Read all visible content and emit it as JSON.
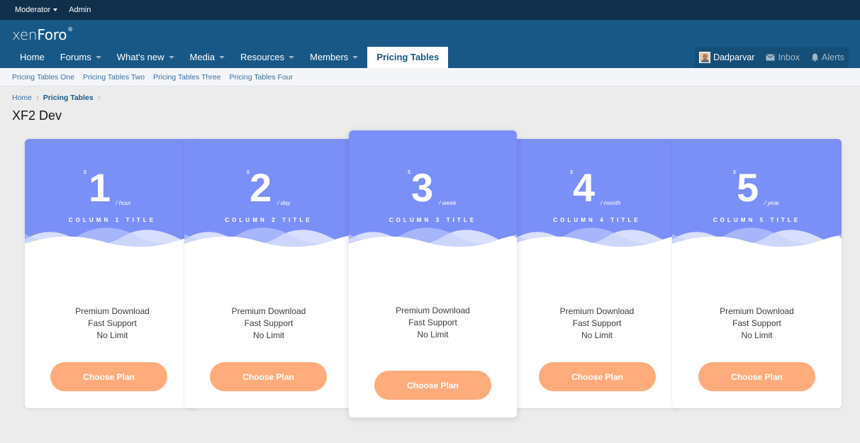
{
  "staff_bar": {
    "moderator": "Moderator",
    "admin": "Admin"
  },
  "logo": {
    "part1": "xen",
    "part2": "Foro",
    "mark": "®"
  },
  "nav": {
    "home": "Home",
    "forums": "Forums",
    "whats_new": "What's new",
    "media": "Media",
    "resources": "Resources",
    "members": "Members",
    "pricing_tables": "Pricing Tables"
  },
  "user_nav": {
    "username": "Dadparvar",
    "inbox": "Inbox",
    "alerts": "Alerts"
  },
  "sub_nav": [
    "Pricing Tables One",
    "Pricing Tables Two",
    "Pricing Tables Three",
    "Pricing Tables Four"
  ],
  "breadcrumb": {
    "home": "Home",
    "current": "Pricing Tables",
    "sep": "›"
  },
  "page_title": "XF2 Dev",
  "colors": {
    "card_top": "#7b8ff9",
    "button": "#ffab7b",
    "header": "#185886",
    "staff_bar": "#0f2f4b"
  },
  "plans": [
    {
      "currency": "$",
      "amount": "1",
      "period": "/ hour",
      "title": "COLUMN 1 TITLE",
      "features": [
        "Premium Download",
        "Fast Support",
        "No Limit"
      ],
      "button": "Choose Plan",
      "featured": false
    },
    {
      "currency": "$",
      "amount": "2",
      "period": "/ day",
      "title": "COLUMN 2 TITLE",
      "features": [
        "Premium Download",
        "Fast Support",
        "No Limit"
      ],
      "button": "Choose Plan",
      "featured": false
    },
    {
      "currency": "$",
      "amount": "3",
      "period": "/ week",
      "title": "COLUMN 3 TITLE",
      "features": [
        "Premium Download",
        "Fast Support",
        "No Limit"
      ],
      "button": "Choose Plan",
      "featured": true
    },
    {
      "currency": "$",
      "amount": "4",
      "period": "/ month",
      "title": "COLUMN 4 TITLE",
      "features": [
        "Premium Download",
        "Fast Support",
        "No Limit"
      ],
      "button": "Choose Plan",
      "featured": false
    },
    {
      "currency": "$",
      "amount": "5",
      "period": "/ year",
      "title": "COLUMN 5 TITLE",
      "features": [
        "Premium Download",
        "Fast Support",
        "No Limit"
      ],
      "button": "Choose Plan",
      "featured": false
    }
  ]
}
